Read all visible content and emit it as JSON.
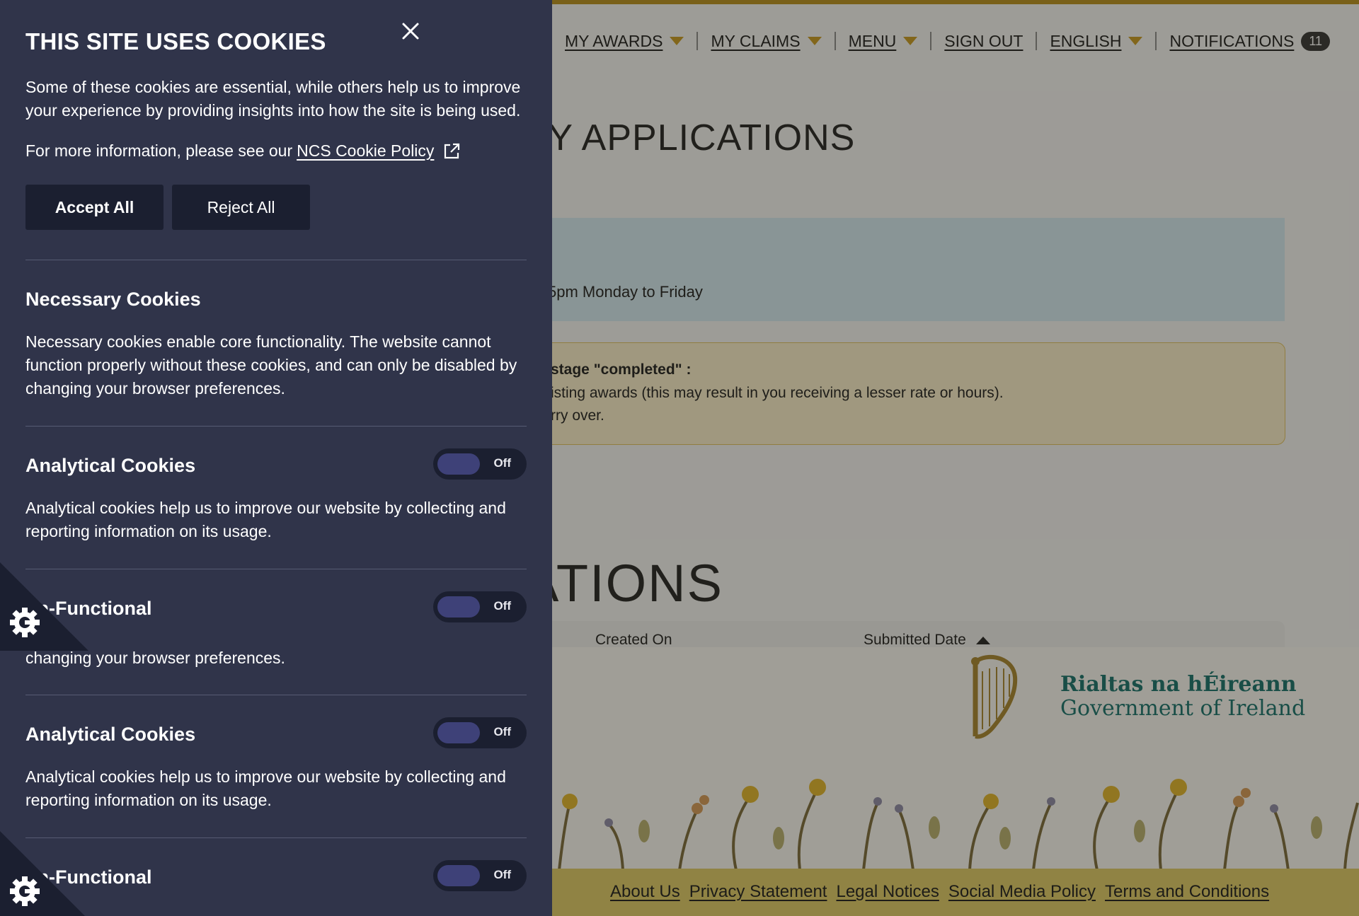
{
  "nav": {
    "my_awards": "MY AWARDS",
    "my_claims": "MY CLAIMS",
    "menu": "MENU",
    "sign_out": "SIGN OUT",
    "language": "ENGLISH",
    "notifications": "NOTIFICATIONS",
    "notifications_count": "11"
  },
  "page": {
    "heading": "MY APPLICATIONS",
    "info_text": "5pm Monday to Friday",
    "warning_title": "stage \"completed\" :",
    "warning_line_1": "isting awards (this may result in you receiving a lesser rate or hours).",
    "warning_line_2": "rry over.",
    "section_heading": "ATIONS",
    "table_headers": {
      "created_on": "Created On",
      "submitted_date": "Submitted Date"
    }
  },
  "footer": {
    "gov_line_1": "Rialtas na hÉireann",
    "gov_line_2": "Government of Ireland",
    "links": [
      "About Us",
      "Privacy Statement",
      "Legal Notices",
      "Social Media Policy",
      "Terms and Conditions"
    ]
  },
  "cookie": {
    "title": "THIS SITE USES COOKIES",
    "intro": "Some of these cookies are essential, while others help us to improve your experience by providing insights into how the site is being used.",
    "more_prefix": "For more information, please see our",
    "policy_link": "NCS Cookie Policy",
    "accept_label": "Accept All",
    "reject_label": "Reject All",
    "necessary": {
      "title": "Necessary Cookies",
      "desc": "Necessary cookies enable core functionality. The website cannot function properly without these cookies, and can only be disabled by changing your browser preferences."
    },
    "analytical": {
      "title": "Analytical Cookies",
      "desc": "Analytical cookies help us to improve our website by collecting and reporting information on its usage.",
      "state": "Off"
    },
    "nonfunctional": {
      "title": "on-Functional",
      "desc_partial": "changing your browser preferences.",
      "state": "Off"
    },
    "analytical_2": {
      "title": "Analytical Cookies",
      "desc": "Analytical cookies help us to improve our website by collecting and reporting information on its usage.",
      "state": "Off"
    },
    "nonfunctional_2": {
      "title": "on-Functional",
      "state": "Off"
    }
  },
  "colors": {
    "panel_bg": "#30344a",
    "button_bg": "#1b1f30",
    "toggle_knob": "#3e4178",
    "gov_teal": "#13706b",
    "accent_gold": "#c89a1f"
  }
}
